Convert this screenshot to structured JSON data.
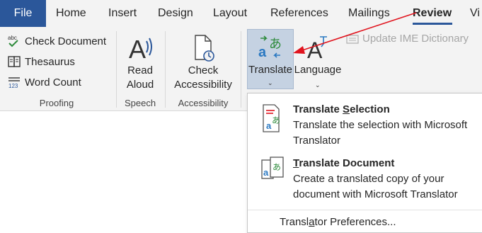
{
  "tabs": {
    "file": "File",
    "home": "Home",
    "insert": "Insert",
    "design": "Design",
    "layout": "Layout",
    "references": "References",
    "mailings": "Mailings",
    "review": "Review",
    "view_partial": "Vi"
  },
  "proofing": {
    "check_document": "Check Document",
    "thesaurus": "Thesaurus",
    "word_count": "Word Count",
    "label": "Proofing"
  },
  "speech": {
    "read_aloud_line1": "Read",
    "read_aloud_line2": "Aloud",
    "label": "Speech"
  },
  "accessibility": {
    "check_line1": "Check",
    "check_line2": "Accessibility",
    "label": "Accessibility"
  },
  "language": {
    "translate": "Translate",
    "language": "Language",
    "update_ime": "Update IME Dictionary"
  },
  "translate_menu": {
    "selection": {
      "title_pre": "Translate ",
      "title_u": "S",
      "title_post": "election",
      "desc": "Translate the selection with Microsoft Translator"
    },
    "document": {
      "title_pre": "",
      "title_u": "T",
      "title_post": "ranslate Document",
      "desc": "Create a translated copy of your document with Microsoft Translator"
    },
    "preferences_pre": "Transl",
    "preferences_u": "a",
    "preferences_post": "tor Preferences..."
  },
  "colors": {
    "file_tab": "#2b579a",
    "ribbon_bg": "#f3f3f3",
    "translate_highlight": "#c5d2e2",
    "annotation_arrow": "#e0141e"
  }
}
